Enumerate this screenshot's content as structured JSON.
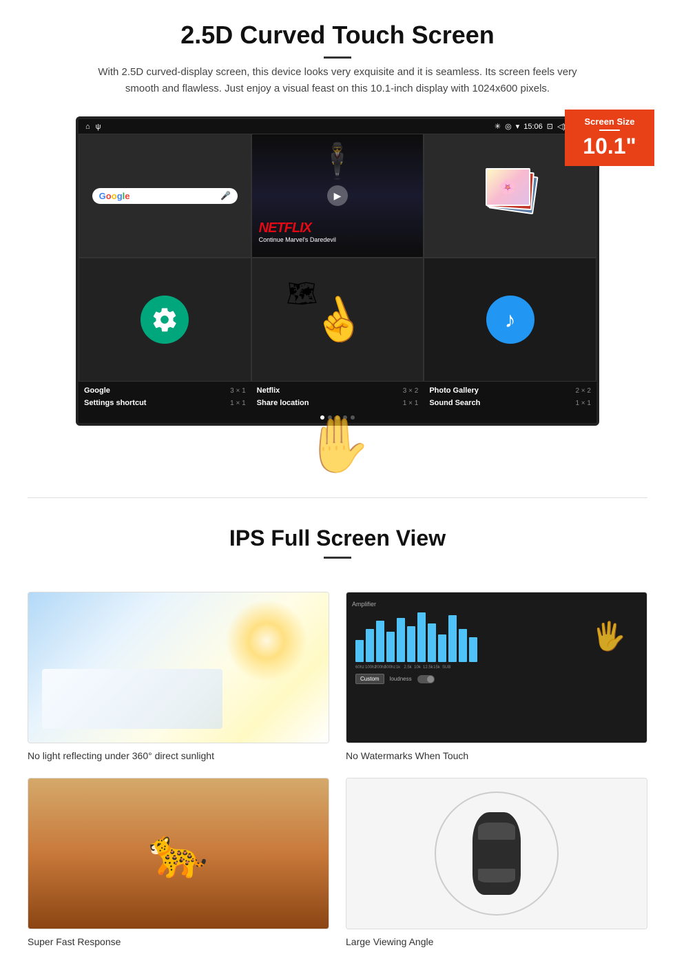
{
  "section1": {
    "title": "2.5D Curved Touch Screen",
    "description": "With 2.5D curved-display screen, this device looks very exquisite and it is seamless. Its screen feels very smooth and flawless. Just enjoy a visual feast on this 10.1-inch display with 1024x600 pixels."
  },
  "screen_badge": {
    "label": "Screen Size",
    "size": "10.1\""
  },
  "status_bar": {
    "time": "15:06"
  },
  "apps": [
    {
      "name": "Google",
      "size": "3 × 1"
    },
    {
      "name": "Netflix",
      "size": "3 × 2"
    },
    {
      "name": "Photo Gallery",
      "size": "2 × 2"
    },
    {
      "name": "Settings shortcut",
      "size": "1 × 1"
    },
    {
      "name": "Share location",
      "size": "1 × 1"
    },
    {
      "name": "Sound Search",
      "size": "1 × 1"
    }
  ],
  "netflix": {
    "logo": "NETFLIX",
    "subtitle": "Continue Marvel's Daredevil"
  },
  "section2": {
    "title": "IPS Full Screen View"
  },
  "features": [
    {
      "caption": "No light reflecting under 360° direct sunlight"
    },
    {
      "caption": "No Watermarks When Touch"
    },
    {
      "caption": "Super Fast Response"
    },
    {
      "caption": "Large Viewing Angle"
    }
  ],
  "amp_bars": [
    40,
    60,
    75,
    55,
    80,
    65,
    90,
    70,
    50,
    85,
    60,
    45
  ],
  "amp_labels": [
    "60hz",
    "100hz",
    "200hz",
    "500hz",
    "1k",
    "2.5k",
    "10k",
    "12.5k",
    "15k",
    "SUB"
  ]
}
